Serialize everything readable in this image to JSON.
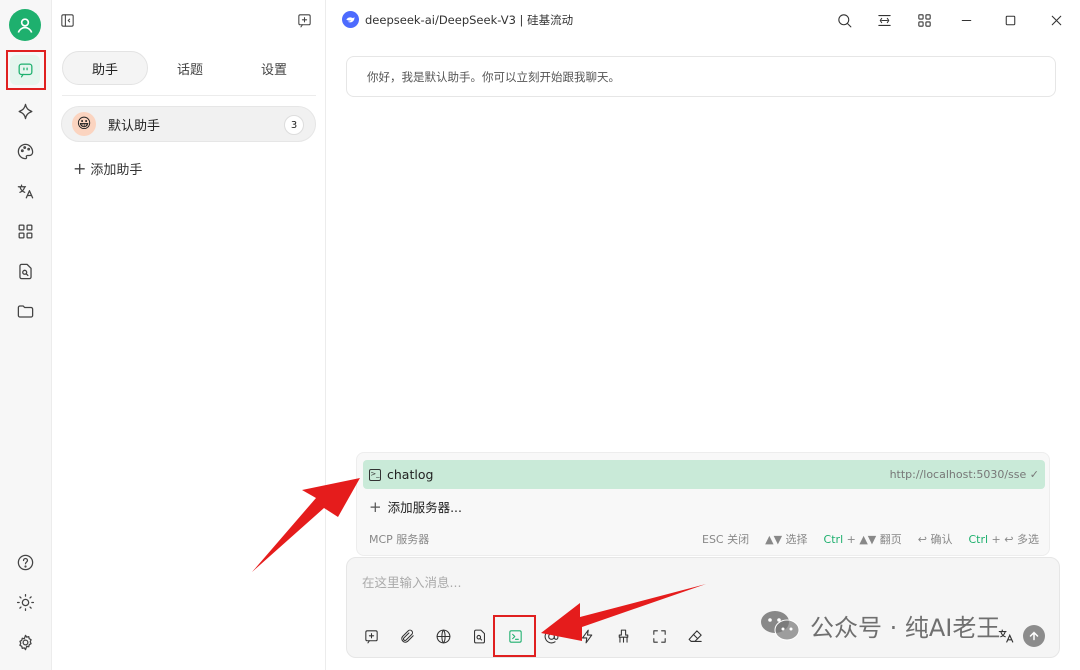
{
  "sidebar_rail": {
    "icons": [
      "user-avatar-icon",
      "chat-icon",
      "sparkle-icon",
      "palette-icon",
      "translate-icon",
      "apps-grid-icon",
      "file-search-icon",
      "folder-icon",
      "help-icon",
      "theme-sun-icon",
      "settings-gear-icon"
    ]
  },
  "assistant_panel": {
    "tabs": [
      {
        "label": "助手",
        "active": true
      },
      {
        "label": "话题",
        "active": false
      },
      {
        "label": "设置",
        "active": false
      }
    ],
    "assistant": {
      "name": "默认助手",
      "count": "3"
    },
    "add_label": "添加助手"
  },
  "header": {
    "model": "deepseek-ai/DeepSeek-V3 | 硅基流动"
  },
  "chat": {
    "greeting": "你好，我是默认助手。你可以立刻开始跟我聊天。"
  },
  "mcp_popup": {
    "server": {
      "name": "chatlog",
      "url": "http://localhost:5030/sse ✓"
    },
    "add_label": "添加服务器...",
    "footer_left": "MCP 服务器",
    "hints": [
      {
        "pre": "",
        "key": "",
        "post": "ESC 关闭"
      },
      {
        "pre": "",
        "key": "",
        "post": "▲▼ 选择"
      },
      {
        "pre": "",
        "key": "Ctrl",
        "post": " + ▲▼ 翻页"
      },
      {
        "pre": "",
        "key": "",
        "post": "↩ 确认"
      },
      {
        "pre": "",
        "key": "Ctrl",
        "post": " + ↩ 多选"
      }
    ]
  },
  "input": {
    "placeholder": "在这里输入消息..."
  },
  "watermark": "公众号 · 纯AI老王",
  "colors": {
    "accent": "#1eb06e",
    "highlight": "#c9ead8",
    "annotation": "#e02020"
  }
}
